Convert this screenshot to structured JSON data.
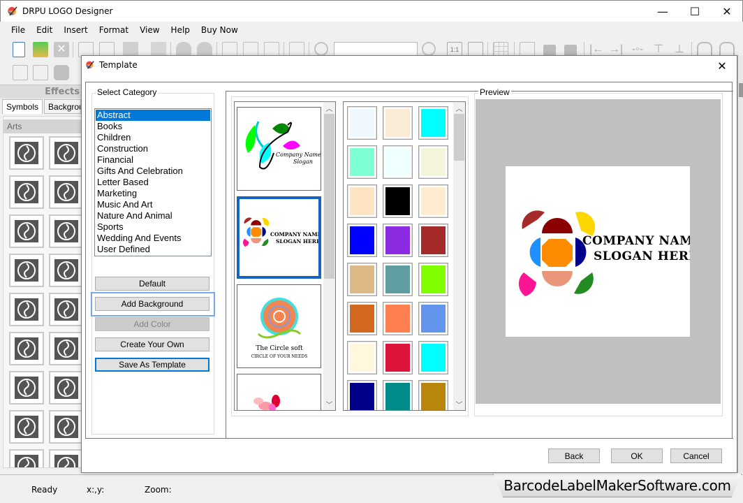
{
  "window": {
    "title": "DRPU LOGO Designer",
    "controls": {
      "minimize": "—",
      "maximize": "☐",
      "close": "✕"
    }
  },
  "menu": [
    "File",
    "Edit",
    "Insert",
    "Format",
    "View",
    "Help",
    "Buy Now"
  ],
  "left_panel": {
    "header": "Effects",
    "tabs": [
      {
        "label": "Symbols",
        "active": true
      },
      {
        "label": "Backgrounds",
        "active": false
      }
    ],
    "section": "Arts",
    "symbols": [
      "triskele-symbol",
      "celtic-knot-symbol",
      "cross-pattern-symbol",
      "diamond-knot-symbol",
      "ornament-symbol-1",
      "ornament-symbol-2",
      "clover-symbol",
      "swirl-dots-symbol",
      "fleur-symbol",
      "scroll-symbol",
      "diamond-leaf-symbol",
      "fan-symbol",
      "diamond-fan-symbol",
      "tree-symbol",
      "mandala-symbol",
      "flourish-symbol",
      "heart-knot-symbol",
      "curve-symbol"
    ]
  },
  "dialog": {
    "title": "Template",
    "close": "✕",
    "category": {
      "label": "Select Category",
      "items": [
        "Abstract",
        "Books",
        "Children",
        "Construction",
        "Financial",
        "Gifts And Celebration",
        "Letter Based",
        "Marketing",
        "Music And Art",
        "Nature And Animal",
        "Sports",
        "Wedding And Events",
        "User Defined"
      ],
      "selected": "Abstract"
    },
    "buttons": {
      "default": "Default",
      "add_background": "Add Background",
      "add_color": "Add Color",
      "create_your_own": "Create Your Own",
      "save_as_template": "Save As Template"
    },
    "templates": [
      {
        "name": "leaf-swirl-logo",
        "line1": "Company Name",
        "line2": "Slogan",
        "selected": false
      },
      {
        "name": "flower-octagon-logo",
        "line1": "COMPANY NAME",
        "line2": "SLOGAN HERE",
        "selected": true
      },
      {
        "name": "circle-soft-logo",
        "line1": "The Circle soft",
        "line2": "CIRCLE OF YOUR NEEDS",
        "selected": false
      },
      {
        "name": "butterfly-logo",
        "line1": "",
        "line2": "",
        "selected": false
      }
    ],
    "colors": [
      "#f0f8ff",
      "#faebd7",
      "#00ffff",
      "#7fffd4",
      "#f0ffff",
      "#f5f5dc",
      "#ffe4c4",
      "#000000",
      "#ffebcd",
      "#0000ff",
      "#8a2be2",
      "#a52a2a",
      "#deb887",
      "#5f9ea0",
      "#7fff00",
      "#d2691e",
      "#ff7f50",
      "#6495ed",
      "#fff8dc",
      "#dc143c",
      "#00ffff",
      "#00008b",
      "#008b8b",
      "#b8860b"
    ],
    "preview": {
      "label": "Preview",
      "line1": "COMPANY NAME",
      "line2": "SLOGAN HERE"
    },
    "footer": {
      "back": "Back",
      "ok": "OK",
      "cancel": "Cancel"
    }
  },
  "status": {
    "ready": "Ready",
    "xy": "x:,y:",
    "zoom": "Zoom:"
  },
  "watermark": "BarcodeLabelMakerSoftware.com"
}
